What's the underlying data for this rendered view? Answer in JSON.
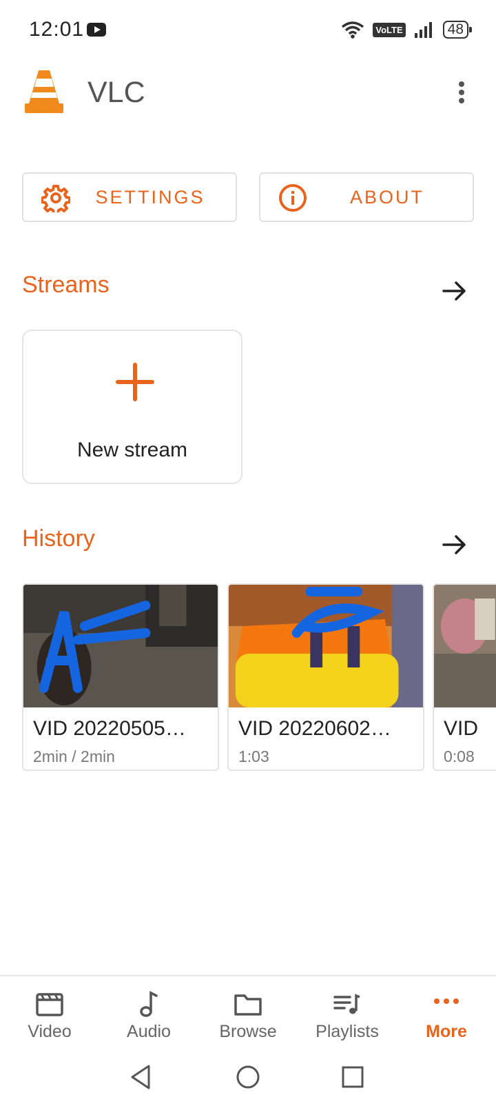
{
  "status_bar": {
    "time": "12:01",
    "network_label": "VoLTE",
    "battery_level": "48"
  },
  "app_bar": {
    "title": "VLC"
  },
  "buttons": {
    "settings_label": "SETTINGS",
    "about_label": "ABOUT"
  },
  "streams": {
    "title": "Streams",
    "new_stream_label": "New stream"
  },
  "history": {
    "title": "History",
    "items": [
      {
        "title": "VID 20220505…",
        "subtitle": "2min / 2min"
      },
      {
        "title": "VID 20220602…",
        "subtitle": "1:03"
      },
      {
        "title": "VID",
        "subtitle": "0:08"
      }
    ]
  },
  "bottom_nav": {
    "items": [
      {
        "label": "Video",
        "icon": "clapperboard-icon"
      },
      {
        "label": "Audio",
        "icon": "music-note-icon"
      },
      {
        "label": "Browse",
        "icon": "folder-icon"
      },
      {
        "label": "Playlists",
        "icon": "playlist-icon"
      },
      {
        "label": "More",
        "icon": "more-dots-icon",
        "active": true
      }
    ]
  },
  "colors": {
    "accent": "#e8631b",
    "text": "#222222",
    "muted": "#777777"
  }
}
